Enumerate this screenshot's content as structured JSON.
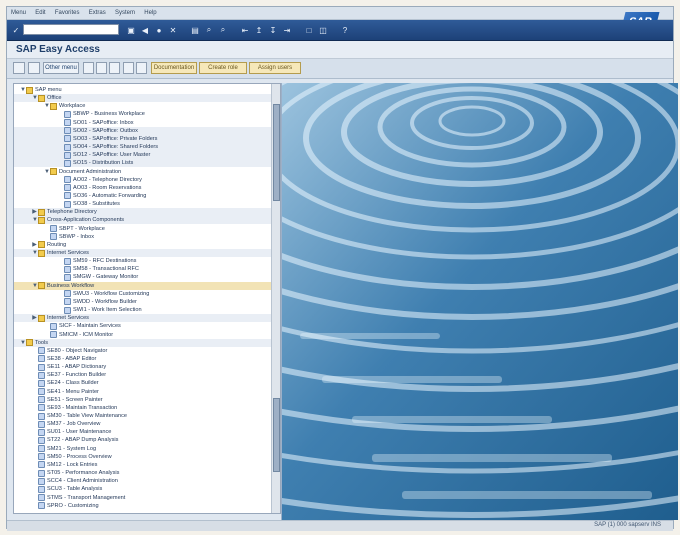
{
  "menu": {
    "items": [
      "Menu",
      "Edit",
      "Favorites",
      "Extras",
      "System",
      "Help"
    ]
  },
  "logo": {
    "brand": "SAP"
  },
  "command": {
    "value": ""
  },
  "window": {
    "title": "SAP Easy Access"
  },
  "toolbar": {
    "buttons": [
      {
        "label": ""
      },
      {
        "label": ""
      },
      {
        "label": "Other menu"
      },
      {
        "label": ""
      },
      {
        "label": ""
      },
      {
        "label": ""
      },
      {
        "label": ""
      },
      {
        "label": ""
      },
      {
        "label": "Documentation"
      },
      {
        "label": "Create role"
      },
      {
        "label": "Assign users"
      }
    ]
  },
  "tree": {
    "items": [
      {
        "label": "SAP menu",
        "indent": 58,
        "kind": "folder",
        "exp": "▼",
        "band": false
      },
      {
        "label": "Office",
        "indent": 70,
        "kind": "folder",
        "exp": "▼",
        "band": true
      },
      {
        "label": "Workplace",
        "indent": 82,
        "kind": "folder",
        "exp": "▼",
        "band": false
      },
      {
        "label": "SBWP - Business Workplace",
        "indent": 96,
        "kind": "tx",
        "exp": "",
        "band": false
      },
      {
        "label": "SO01 - SAPoffice: Inbox",
        "indent": 96,
        "kind": "tx",
        "exp": "",
        "band": false
      },
      {
        "label": "SO02 - SAPoffice: Outbox",
        "indent": 96,
        "kind": "tx",
        "exp": "",
        "band": true
      },
      {
        "label": "SO03 - SAPoffice: Private Folders",
        "indent": 96,
        "kind": "tx",
        "exp": "",
        "band": true
      },
      {
        "label": "SO04 - SAPoffice: Shared Folders",
        "indent": 96,
        "kind": "tx",
        "exp": "",
        "band": true
      },
      {
        "label": "SO12 - SAPoffice: User Master",
        "indent": 96,
        "kind": "tx",
        "exp": "",
        "band": true
      },
      {
        "label": "SO15 - Distribution Lists",
        "indent": 96,
        "kind": "tx",
        "exp": "",
        "band": true
      },
      {
        "label": "Document Administration",
        "indent": 82,
        "kind": "folder",
        "exp": "▼",
        "band": false
      },
      {
        "label": "AO02 - Telephone Directory",
        "indent": 96,
        "kind": "tx",
        "exp": "",
        "band": false
      },
      {
        "label": "AO03 - Room Reservations",
        "indent": 96,
        "kind": "tx",
        "exp": "",
        "band": false
      },
      {
        "label": "SO36 - Automatic Forwarding",
        "indent": 96,
        "kind": "tx",
        "exp": "",
        "band": false
      },
      {
        "label": "SO38 - Substitutes",
        "indent": 96,
        "kind": "tx",
        "exp": "",
        "band": false
      },
      {
        "label": "Telephone Directory",
        "indent": 70,
        "kind": "folder",
        "exp": "▶",
        "band": true
      },
      {
        "label": "Cross-Application Components",
        "indent": 70,
        "kind": "folder",
        "exp": "▼",
        "band": true
      },
      {
        "label": "SBPT - Workplace",
        "indent": 82,
        "kind": "tx",
        "exp": "",
        "band": false
      },
      {
        "label": "SBWP - Inbox",
        "indent": 82,
        "kind": "tx",
        "exp": "",
        "band": false
      },
      {
        "label": "Routing",
        "indent": 70,
        "kind": "folder",
        "exp": "▶",
        "band": false
      },
      {
        "label": "Internet Services",
        "indent": 70,
        "kind": "folder",
        "exp": "▼",
        "band": true
      },
      {
        "label": "SM59 - RFC Destinations",
        "indent": 96,
        "kind": "tx",
        "exp": "",
        "band": false
      },
      {
        "label": "SM58 - Transactional RFC",
        "indent": 96,
        "kind": "tx",
        "exp": "",
        "band": false
      },
      {
        "label": "SMGW - Gateway Monitor",
        "indent": 96,
        "kind": "tx",
        "exp": "",
        "band": false
      },
      {
        "label": "Business Workflow",
        "indent": 70,
        "kind": "folder",
        "exp": "▼",
        "band": true,
        "sel": true
      },
      {
        "label": "SWU3 - Workflow Customizing",
        "indent": 96,
        "kind": "tx",
        "exp": "",
        "band": false
      },
      {
        "label": "SWDD - Workflow Builder",
        "indent": 96,
        "kind": "tx",
        "exp": "",
        "band": false
      },
      {
        "label": "SWI1 - Work Item Selection",
        "indent": 96,
        "kind": "tx",
        "exp": "",
        "band": false
      },
      {
        "label": "Internet Services",
        "indent": 70,
        "kind": "folder",
        "exp": "▶",
        "band": true
      },
      {
        "label": "SICF - Maintain Services",
        "indent": 82,
        "kind": "tx",
        "exp": "",
        "band": false
      },
      {
        "label": "SMICM - ICM Monitor",
        "indent": 82,
        "kind": "tx",
        "exp": "",
        "band": false
      },
      {
        "label": "Tools",
        "indent": 58,
        "kind": "folder",
        "exp": "▼",
        "band": true
      },
      {
        "label": "SE80 - Object Navigator",
        "indent": 70,
        "kind": "tx",
        "exp": "",
        "band": false
      },
      {
        "label": "SE38 - ABAP Editor",
        "indent": 70,
        "kind": "tx",
        "exp": "",
        "band": false
      },
      {
        "label": "SE11 - ABAP Dictionary",
        "indent": 70,
        "kind": "tx",
        "exp": "",
        "band": false
      },
      {
        "label": "SE37 - Function Builder",
        "indent": 70,
        "kind": "tx",
        "exp": "",
        "band": false
      },
      {
        "label": "SE24 - Class Builder",
        "indent": 70,
        "kind": "tx",
        "exp": "",
        "band": false
      },
      {
        "label": "SE41 - Menu Painter",
        "indent": 70,
        "kind": "tx",
        "exp": "",
        "band": false
      },
      {
        "label": "SE51 - Screen Painter",
        "indent": 70,
        "kind": "tx",
        "exp": "",
        "band": false
      },
      {
        "label": "SE93 - Maintain Transaction",
        "indent": 70,
        "kind": "tx",
        "exp": "",
        "band": false
      },
      {
        "label": "SM30 - Table View Maintenance",
        "indent": 70,
        "kind": "tx",
        "exp": "",
        "band": false
      },
      {
        "label": "SM37 - Job Overview",
        "indent": 70,
        "kind": "tx",
        "exp": "",
        "band": false
      },
      {
        "label": "SU01 - User Maintenance",
        "indent": 70,
        "kind": "tx",
        "exp": "",
        "band": false
      },
      {
        "label": "ST22 - ABAP Dump Analysis",
        "indent": 70,
        "kind": "tx",
        "exp": "",
        "band": false
      },
      {
        "label": "SM21 - System Log",
        "indent": 70,
        "kind": "tx",
        "exp": "",
        "band": false
      },
      {
        "label": "SM50 - Process Overview",
        "indent": 70,
        "kind": "tx",
        "exp": "",
        "band": false
      },
      {
        "label": "SM12 - Lock Entries",
        "indent": 70,
        "kind": "tx",
        "exp": "",
        "band": false
      },
      {
        "label": "ST05 - Performance Analysis",
        "indent": 70,
        "kind": "tx",
        "exp": "",
        "band": false
      },
      {
        "label": "SCC4 - Client Administration",
        "indent": 70,
        "kind": "tx",
        "exp": "",
        "band": false
      },
      {
        "label": "SCU3 - Table Analysis",
        "indent": 70,
        "kind": "tx",
        "exp": "",
        "band": false
      },
      {
        "label": "STMS - Transport Management",
        "indent": 70,
        "kind": "tx",
        "exp": "",
        "band": false
      },
      {
        "label": "SPRO - Customizing",
        "indent": 70,
        "kind": "tx",
        "exp": "",
        "band": false
      }
    ]
  },
  "status": {
    "text": "SAP (1) 000  sapserv  INS"
  }
}
